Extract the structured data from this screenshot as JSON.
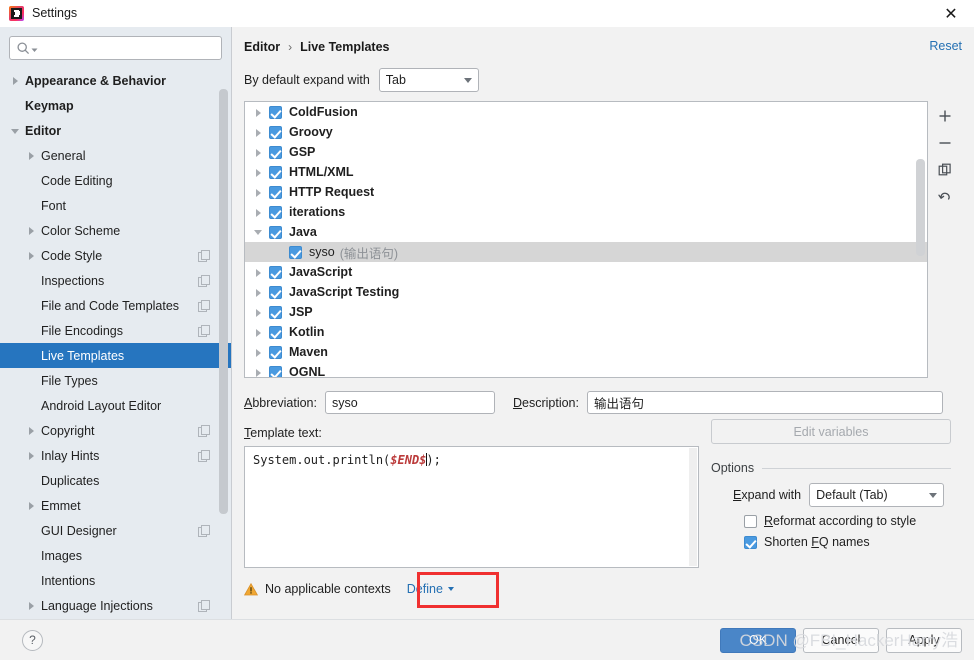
{
  "window": {
    "title": "Settings",
    "app_icon": "intellij-idea-logo",
    "close_icon": "close-icon"
  },
  "sidebar": {
    "search": {
      "placeholder": "",
      "value": "",
      "icon": "search-icon"
    },
    "items": [
      {
        "label": "Appearance & Behavior",
        "arrow": "right",
        "indent": 0,
        "bold": true,
        "selected": false,
        "copyable": false
      },
      {
        "label": "Keymap",
        "arrow": "none",
        "indent": 0,
        "bold": true,
        "selected": false,
        "copyable": false
      },
      {
        "label": "Editor",
        "arrow": "down",
        "indent": 0,
        "bold": true,
        "selected": false,
        "copyable": false
      },
      {
        "label": "General",
        "arrow": "right",
        "indent": 1,
        "bold": false,
        "selected": false,
        "copyable": false
      },
      {
        "label": "Code Editing",
        "arrow": "none",
        "indent": 1,
        "bold": false,
        "selected": false,
        "copyable": false
      },
      {
        "label": "Font",
        "arrow": "none",
        "indent": 1,
        "bold": false,
        "selected": false,
        "copyable": false
      },
      {
        "label": "Color Scheme",
        "arrow": "right",
        "indent": 1,
        "bold": false,
        "selected": false,
        "copyable": false
      },
      {
        "label": "Code Style",
        "arrow": "right",
        "indent": 1,
        "bold": false,
        "selected": false,
        "copyable": true
      },
      {
        "label": "Inspections",
        "arrow": "none",
        "indent": 1,
        "bold": false,
        "selected": false,
        "copyable": true
      },
      {
        "label": "File and Code Templates",
        "arrow": "none",
        "indent": 1,
        "bold": false,
        "selected": false,
        "copyable": true
      },
      {
        "label": "File Encodings",
        "arrow": "none",
        "indent": 1,
        "bold": false,
        "selected": false,
        "copyable": true
      },
      {
        "label": "Live Templates",
        "arrow": "none",
        "indent": 1,
        "bold": false,
        "selected": true,
        "copyable": false
      },
      {
        "label": "File Types",
        "arrow": "none",
        "indent": 1,
        "bold": false,
        "selected": false,
        "copyable": false
      },
      {
        "label": "Android Layout Editor",
        "arrow": "none",
        "indent": 1,
        "bold": false,
        "selected": false,
        "copyable": false
      },
      {
        "label": "Copyright",
        "arrow": "right",
        "indent": 1,
        "bold": false,
        "selected": false,
        "copyable": true
      },
      {
        "label": "Inlay Hints",
        "arrow": "right",
        "indent": 1,
        "bold": false,
        "selected": false,
        "copyable": true
      },
      {
        "label": "Duplicates",
        "arrow": "none",
        "indent": 1,
        "bold": false,
        "selected": false,
        "copyable": false
      },
      {
        "label": "Emmet",
        "arrow": "right",
        "indent": 1,
        "bold": false,
        "selected": false,
        "copyable": false
      },
      {
        "label": "GUI Designer",
        "arrow": "none",
        "indent": 1,
        "bold": false,
        "selected": false,
        "copyable": true
      },
      {
        "label": "Images",
        "arrow": "none",
        "indent": 1,
        "bold": false,
        "selected": false,
        "copyable": false
      },
      {
        "label": "Intentions",
        "arrow": "none",
        "indent": 1,
        "bold": false,
        "selected": false,
        "copyable": false
      },
      {
        "label": "Language Injections",
        "arrow": "right",
        "indent": 1,
        "bold": false,
        "selected": false,
        "copyable": true
      }
    ]
  },
  "breadcrumb": {
    "parent": "Editor",
    "separator": "›",
    "current": "Live Templates"
  },
  "reset_link": "Reset",
  "expand_default": {
    "label": "By default expand with",
    "value": "Tab"
  },
  "templates_list": [
    {
      "label": "ColdFusion",
      "desc": "",
      "arrow": "right",
      "checked": true,
      "child": false,
      "selected": false
    },
    {
      "label": "Groovy",
      "desc": "",
      "arrow": "right",
      "checked": true,
      "child": false,
      "selected": false
    },
    {
      "label": "GSP",
      "desc": "",
      "arrow": "right",
      "checked": true,
      "child": false,
      "selected": false
    },
    {
      "label": "HTML/XML",
      "desc": "",
      "arrow": "right",
      "checked": true,
      "child": false,
      "selected": false
    },
    {
      "label": "HTTP Request",
      "desc": "",
      "arrow": "right",
      "checked": true,
      "child": false,
      "selected": false
    },
    {
      "label": "iterations",
      "desc": "",
      "arrow": "right",
      "checked": true,
      "child": false,
      "selected": false
    },
    {
      "label": "Java",
      "desc": "",
      "arrow": "down",
      "checked": true,
      "child": false,
      "selected": false
    },
    {
      "label": "syso",
      "desc": "(输出语句)",
      "arrow": "none",
      "checked": true,
      "child": true,
      "selected": true
    },
    {
      "label": "JavaScript",
      "desc": "",
      "arrow": "right",
      "checked": true,
      "child": false,
      "selected": false
    },
    {
      "label": "JavaScript Testing",
      "desc": "",
      "arrow": "right",
      "checked": true,
      "child": false,
      "selected": false
    },
    {
      "label": "JSP",
      "desc": "",
      "arrow": "right",
      "checked": true,
      "child": false,
      "selected": false
    },
    {
      "label": "Kotlin",
      "desc": "",
      "arrow": "right",
      "checked": true,
      "child": false,
      "selected": false
    },
    {
      "label": "Maven",
      "desc": "",
      "arrow": "right",
      "checked": true,
      "child": false,
      "selected": false
    },
    {
      "label": "OGNL",
      "desc": "",
      "arrow": "right",
      "checked": true,
      "child": false,
      "selected": false
    }
  ],
  "list_tools": [
    {
      "name": "add-template-button",
      "icon": "plus-icon"
    },
    {
      "name": "remove-template-button",
      "icon": "minus-icon"
    },
    {
      "name": "duplicate-template-button",
      "icon": "copy-icon"
    },
    {
      "name": "restore-defaults-button",
      "icon": "undo-icon"
    }
  ],
  "editor": {
    "abbreviation_label": "Abbreviation:",
    "abbreviation_value": "syso",
    "description_label": "Description:",
    "description_value": "输出语句",
    "template_text_label": "Template text:",
    "template_code_prefix": "System.out.println(",
    "template_code_var": "$END$",
    "template_code_suffix": ");",
    "edit_variables_button": "Edit variables"
  },
  "options": {
    "title": "Options",
    "expand_with_label": "Expand with",
    "expand_with_value": "Default (Tab)",
    "reformat_label": "Reformat according to style",
    "reformat_checked": false,
    "shorten_label": "Shorten FQ names",
    "shorten_checked": true
  },
  "contexts": {
    "warning_icon": "warning-triangle-icon",
    "message": "No applicable contexts",
    "define_link": "Define",
    "define_caret_icon": "chevron-down-icon"
  },
  "footer": {
    "help_icon": "question-mark-icon",
    "ok": "OK",
    "cancel": "Cancel",
    "apply": "Apply"
  },
  "watermark": "CSDN @FBI_HackerHarry浩",
  "colors": {
    "accent_blue": "#2675bf",
    "link_blue": "#2470b3",
    "checkbox_blue": "#4a9ae0",
    "sidebar_bg": "#e6ebf0",
    "panel_bg": "#f2f2f2",
    "annotation_red": "#f03030",
    "template_var_red": "#bb3a3a"
  }
}
